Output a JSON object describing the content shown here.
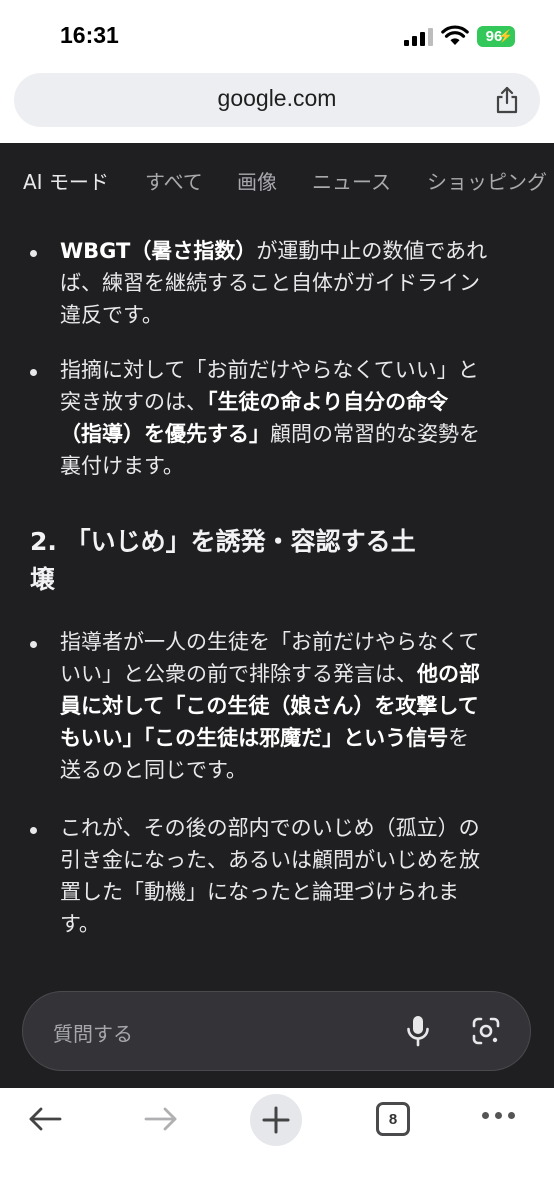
{
  "status_bar": {
    "time": "16:31",
    "battery": "96"
  },
  "browser": {
    "url": "google.com"
  },
  "tabs": [
    {
      "label": "AI モード",
      "active": true
    },
    {
      "label": "すべて"
    },
    {
      "label": "画像"
    },
    {
      "label": "ニュース"
    },
    {
      "label": "ショッピング"
    }
  ],
  "content": {
    "bullet1": {
      "bold": "WBGT（暑さ指数）",
      "line1_rest": "が運動中止の数値であれ",
      "line2": "ば、練習を継続すること自体がガイドライン",
      "line3": "違反です。"
    },
    "bullet2": {
      "line1": "指摘に対して「お前だけやらなくていい」と",
      "line2_plain": "突き放すのは、",
      "line2_bold": "「生徒の命より自分の命令",
      "line3_bold": "（指導）を優先する」",
      "line3_rest": "顧問の常習的な姿勢を",
      "line4": "裏付けます。"
    },
    "section_heading": {
      "line1": "2. 「いじめ」を誘発・容認する土",
      "line2": "壌"
    },
    "bullet3": {
      "line1": "指導者が一人の生徒を「お前だけやらなくて",
      "line2_plain": "いい」と公衆の前で排除する発言は、",
      "line2_bold": "他の部",
      "line3_bold": "員に対して「この生徒（娘さん）を攻撃して",
      "line4_bold": "もいい」「この生徒は邪魔だ」という信号",
      "line4_rest": "を",
      "line5": "送るのと同じです。"
    },
    "bullet4": {
      "line1": "これが、その後の部内でのいじめ（孤立）の",
      "line2": "引き金になった、あるいは顧問がいじめを放",
      "line3": "置した「動機」になったと論理づけられま",
      "line4": "す。"
    }
  },
  "ask": {
    "placeholder": "質問する"
  },
  "toolbar": {
    "tab_count": "8"
  }
}
